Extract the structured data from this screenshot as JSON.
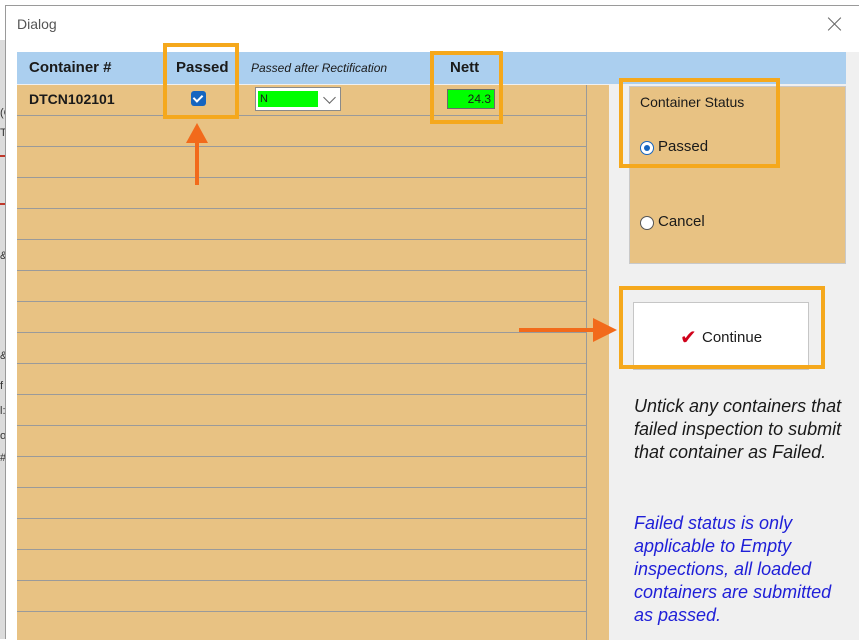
{
  "dialog": {
    "title": "Dialog"
  },
  "table": {
    "headers": {
      "container": "Container #",
      "passed": "Passed",
      "rectification": "Passed after Rectification",
      "nett": "Nett"
    },
    "row": {
      "container": "DTCN102101",
      "passed": true,
      "rectification_value": "N",
      "nett": "24.3"
    }
  },
  "status": {
    "label": "Container  Status",
    "options": [
      {
        "label": "Passed",
        "checked": true
      },
      {
        "label": "Cancel",
        "checked": false
      }
    ]
  },
  "continue_button": {
    "label": "Continue",
    "icon": "checkmark-icon"
  },
  "notes": {
    "black": "Untick any  containers that failed inspection to submit that container as Failed.",
    "blue": "Failed status is only applicable to Empty inspections, all loaded containers are submitted as passed."
  },
  "background_fragments": [
    "(C",
    "T",
    "&",
    "&",
    "f",
    "l:",
    "o:",
    "#"
  ],
  "colors": {
    "grid": "#e8c283",
    "header": "#abcfef",
    "highlight": "#f5a81c",
    "arrow": "#f26a1b",
    "green_field": "#00ff00",
    "note_blue": "#2020d8"
  }
}
